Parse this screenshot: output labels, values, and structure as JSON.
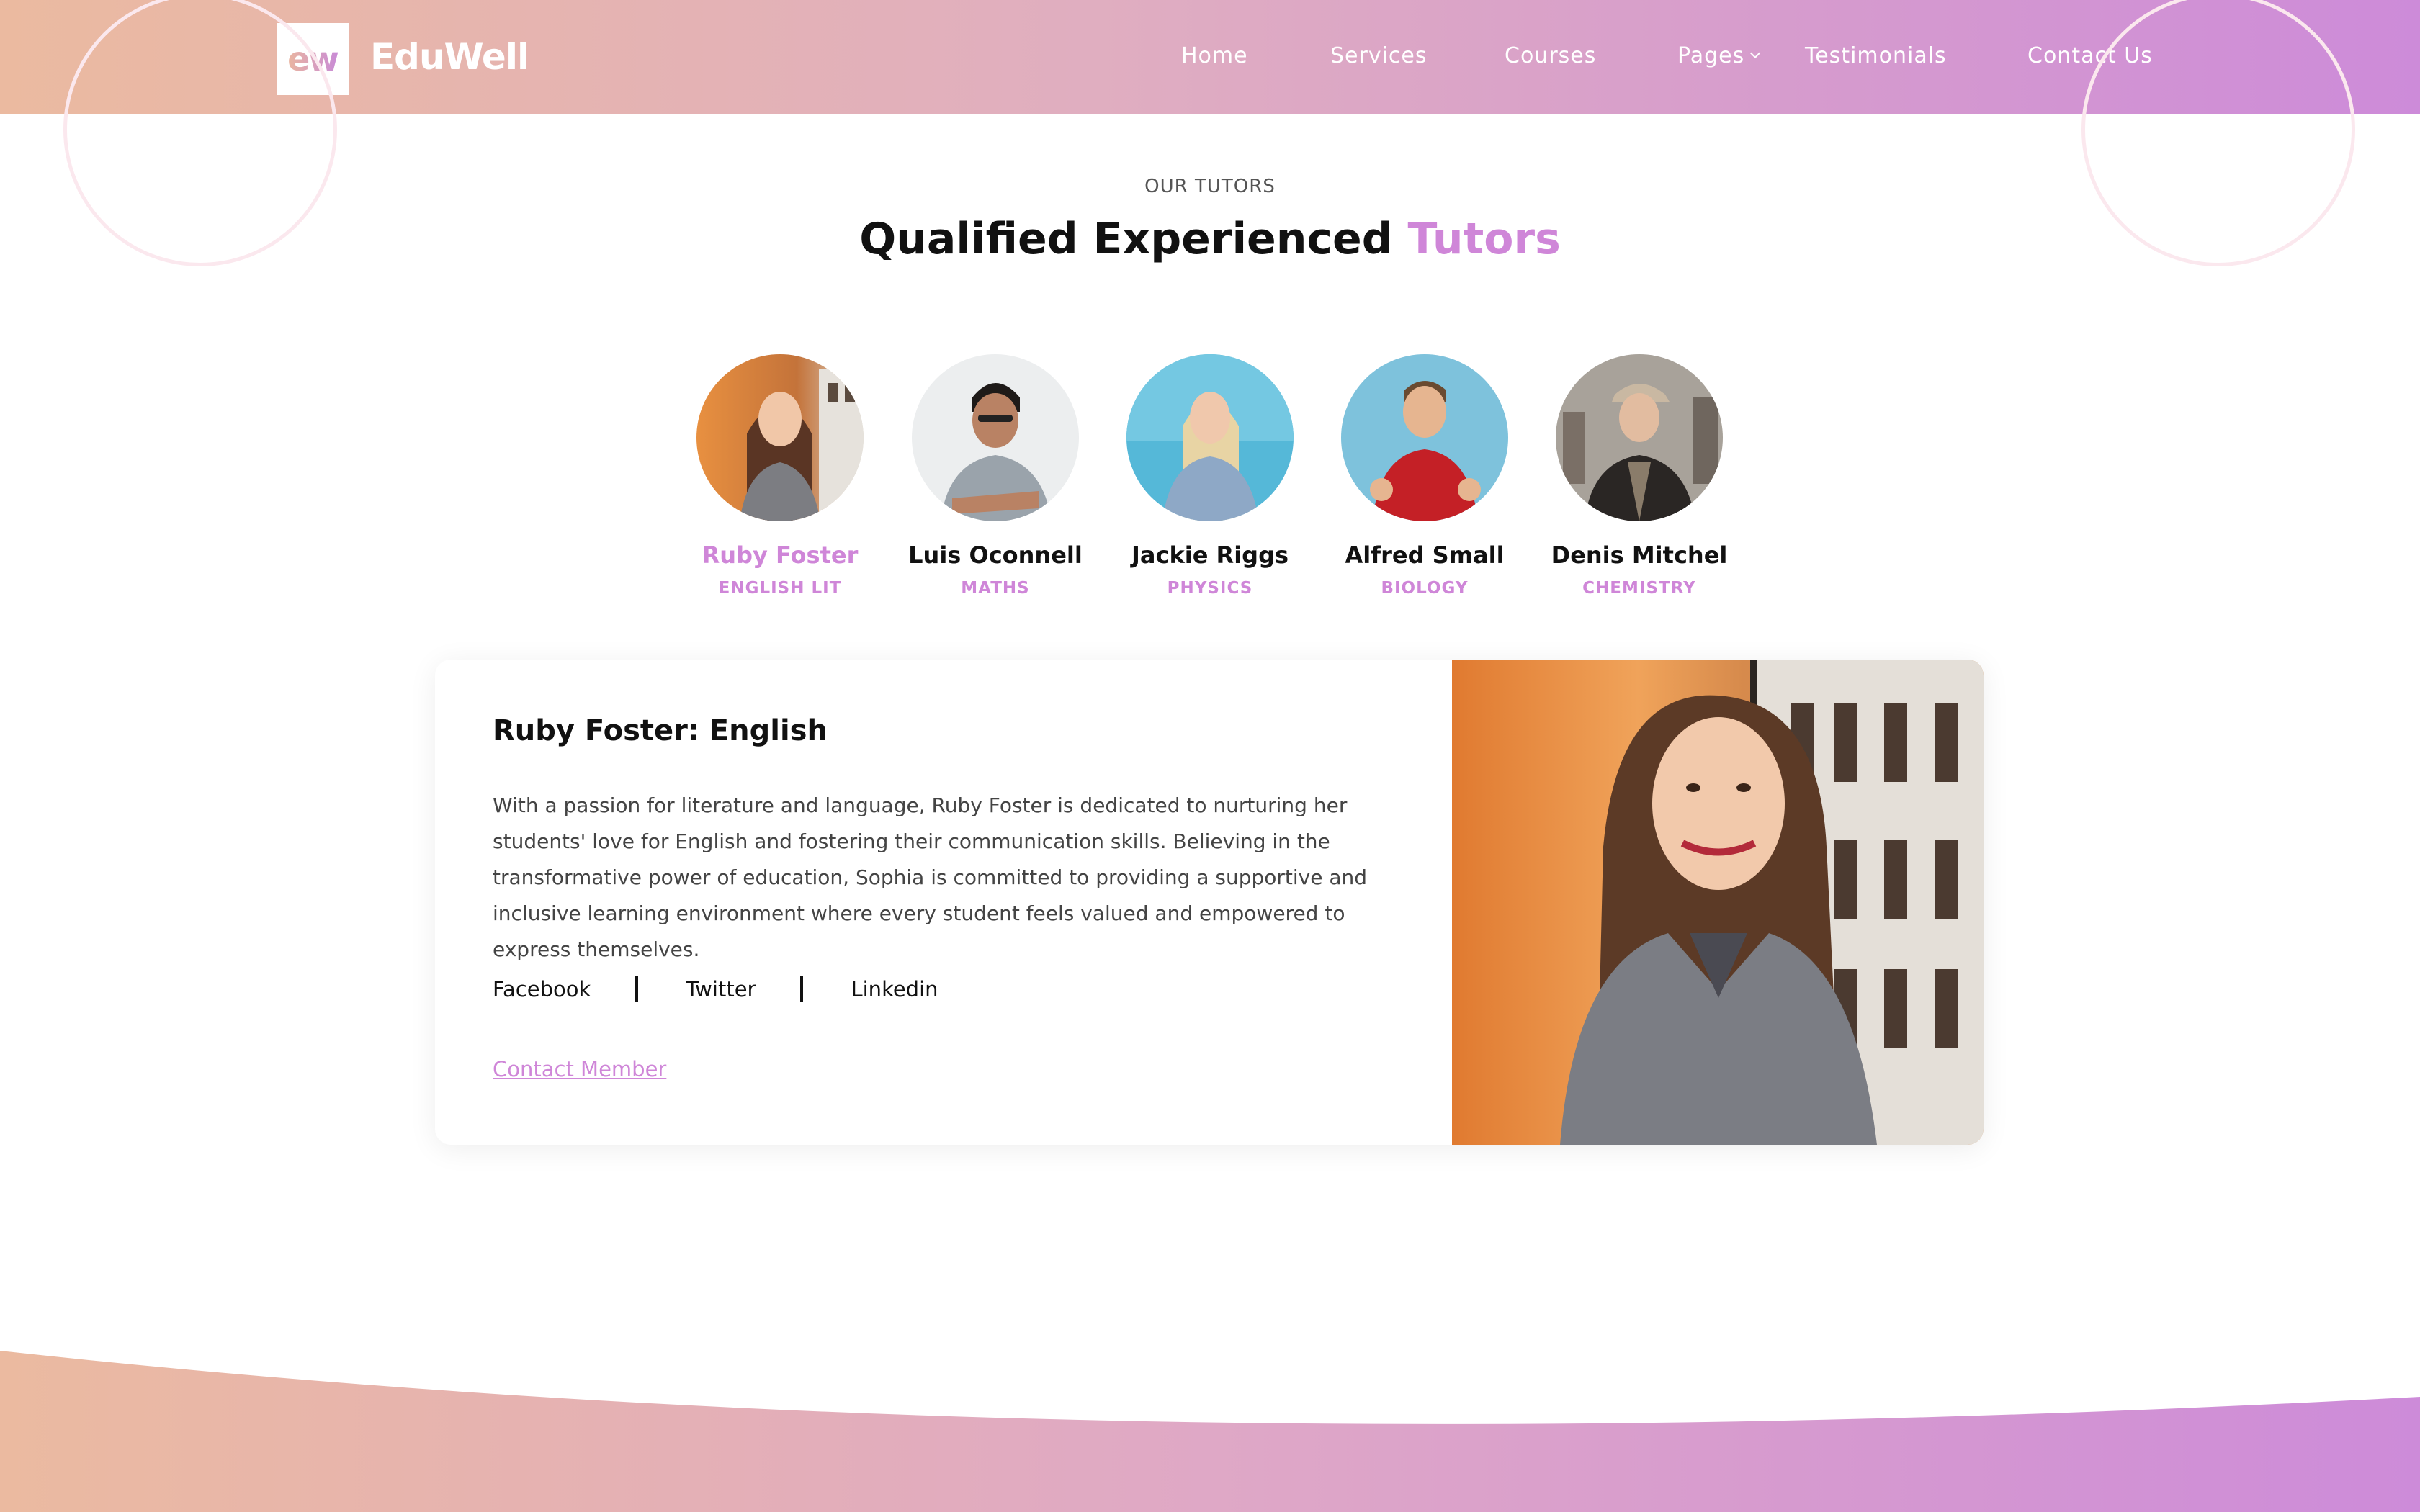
{
  "header": {
    "logo_mark": "ew",
    "brand": "EduWell",
    "nav": [
      {
        "label": "Home"
      },
      {
        "label": "Services"
      },
      {
        "label": "Courses"
      },
      {
        "label": "Pages"
      },
      {
        "label": "Testimonials"
      },
      {
        "label": "Contact Us"
      }
    ]
  },
  "section": {
    "label": "OUR TUTORS",
    "title_main": "Qualified Experienced",
    "title_accent": "Tutors"
  },
  "tutors": [
    {
      "name": "Ruby Foster",
      "subject": "ENGLISH LIT",
      "active": true
    },
    {
      "name": "Luis Oconnell",
      "subject": "MATHS"
    },
    {
      "name": "Jackie Riggs",
      "subject": "PHYSICS"
    },
    {
      "name": "Alfred Small",
      "subject": "BIOLOGY"
    },
    {
      "name": "Denis Mitchel",
      "subject": "CHEMISTRY"
    }
  ],
  "detail": {
    "title": "Ruby Foster: English",
    "bio": "With a passion for literature and language, Ruby Foster is dedicated to nurturing her students' love for English and fostering their communication skills. Believing in the transformative power of education, Sophia is committed to providing a supportive and inclusive learning environment where every student feels valued and empowered to express themselves.",
    "socials": [
      "Facebook",
      "Twitter",
      "Linkedin"
    ],
    "contact_label": "Contact Member"
  },
  "colors": {
    "accent": "#cf86d8",
    "header_gradient_start": "#ebbaa0",
    "header_gradient_end": "#cd8bd9"
  }
}
